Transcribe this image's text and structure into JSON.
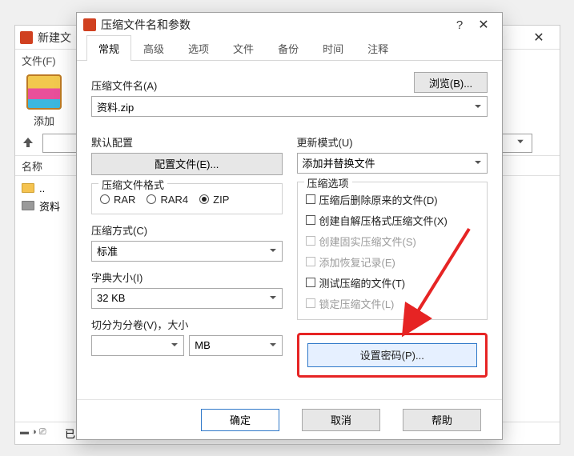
{
  "back": {
    "title": "新建文",
    "menu_file": "文件(F)",
    "add_label": "添加",
    "name_header": "名称",
    "row_up": "..",
    "row_folder": "资料",
    "status": "已"
  },
  "dialog": {
    "title": "压缩文件名和参数",
    "tabs": [
      "常规",
      "高级",
      "选项",
      "文件",
      "备份",
      "时间",
      "注释"
    ],
    "archive_name_label": "压缩文件名(A)",
    "browse": "浏览(B)...",
    "archive_value": "资料.zip",
    "default_profile_label": "默认配置",
    "profile_btn": "配置文件(E)...",
    "format_label": "压缩文件格式",
    "formats": {
      "rar": "RAR",
      "rar4": "RAR4",
      "zip": "ZIP"
    },
    "method_label": "压缩方式(C)",
    "method_value": "标准",
    "dict_label": "字典大小(I)",
    "dict_value": "32 KB",
    "split_label": "切分为分卷(V)，大小",
    "split_unit": "MB",
    "update_label": "更新模式(U)",
    "update_value": "添加并替换文件",
    "options_label": "压缩选项",
    "opts": {
      "delete": "压缩后删除原来的文件(D)",
      "sfx": "创建自解压格式压缩文件(X)",
      "solid": "创建固实压缩文件(S)",
      "recovery": "添加恢复记录(E)",
      "test": "测试压缩的文件(T)",
      "lock": "锁定压缩文件(L)"
    },
    "password_btn": "设置密码(P)...",
    "ok": "确定",
    "cancel": "取消",
    "help": "帮助"
  }
}
